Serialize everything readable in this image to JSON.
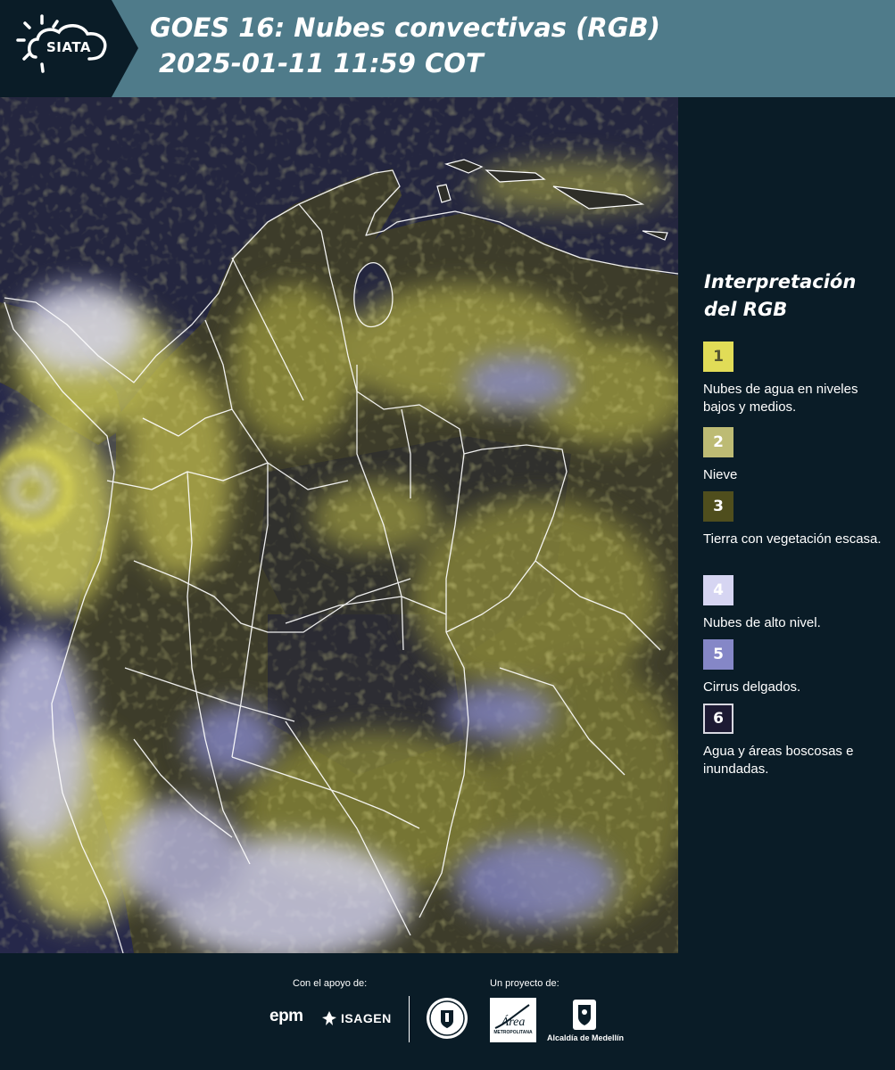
{
  "header": {
    "logo_text": "SIATA",
    "title_line1": "GOES 16: Nubes convectivas (RGB)",
    "title_line2": "2025-01-11 11:59 COT"
  },
  "legend": {
    "title": "Interpretación del RGB",
    "items": [
      {
        "number": "1",
        "label": "Nubes de agua en niveles bajos y medios.",
        "color": "#e1dc57",
        "text_color": "#555530"
      },
      {
        "number": "2",
        "label": "Nieve",
        "color": "#bdbb74",
        "text_color": "#ffffff"
      },
      {
        "number": "3",
        "label": "Tierra con vegetación escasa.",
        "color": "#4f4e1d",
        "text_color": "#ffffff"
      },
      {
        "number": "4",
        "label": "Nubes de alto nivel.",
        "color": "#d6d5f2",
        "text_color": "#ffffff"
      },
      {
        "number": "5",
        "label": "Cirrus delgados.",
        "color": "#8587c7",
        "text_color": "#ffffff"
      },
      {
        "number": "6",
        "label": "Agua y áreas boscosas e inundadas.",
        "color": "#1d1a33",
        "text_color": "#ffffff"
      }
    ]
  },
  "footer": {
    "support_label": "Con el apoyo de:",
    "project_label": "Un proyecto de:",
    "epm_logo": "epm",
    "isagen_logo": "ISAGEN",
    "amva_logo": "Área",
    "amva_sub": "METROPOLITANA",
    "alcaldia_logo": "Alcaldía de Medellín"
  },
  "colors": {
    "header_bg": "#4f7b8a",
    "panel_bg": "#0a1c27",
    "map_ocean": "#26284a",
    "cloud_yellow": "#e1dc57",
    "high_cloud": "#d6d5f2"
  }
}
